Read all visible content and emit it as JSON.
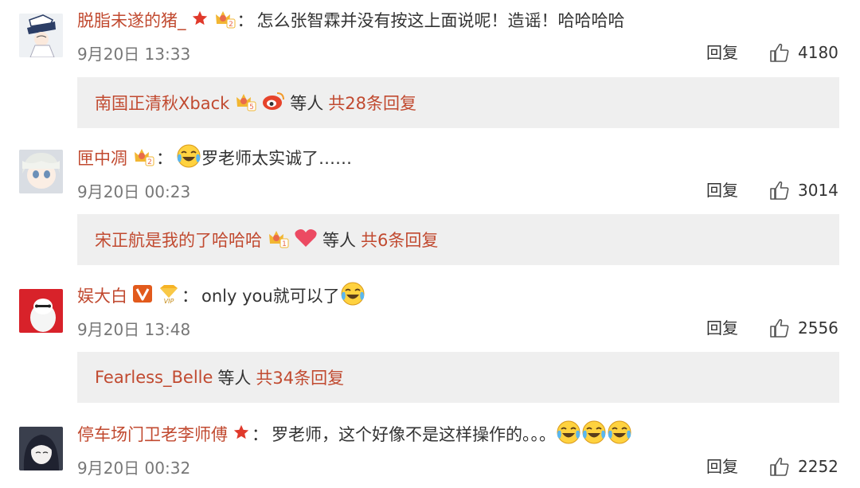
{
  "comments": [
    {
      "username": "脱脂未遂的猪_",
      "separator": "：",
      "text": "怎么张智霖并没有按这上面说呢！造谣！哈哈哈哈",
      "time": "9月20日 13:33",
      "reply_label": "回复",
      "likes": "4180",
      "sub": {
        "name": "南国正清秋Xback",
        "etc": "等人",
        "count": "共28条回复"
      }
    },
    {
      "username": "匣中凋",
      "separator": "：",
      "text": "罗老师太实诚了……",
      "time": "9月20日 00:23",
      "reply_label": "回复",
      "likes": "3014",
      "sub": {
        "name": "宋正航是我的了哈哈哈",
        "etc": "等人",
        "count": "共6条回复"
      }
    },
    {
      "username": "娱大白",
      "separator": "：",
      "text": "only you就可以了",
      "time": "9月20日 13:48",
      "reply_label": "回复",
      "likes": "2556",
      "sub": {
        "name": "Fearless_Belle",
        "etc": "等人",
        "count": "共34条回复"
      }
    },
    {
      "username": "停车场门卫老李师傅",
      "separator": "：",
      "text": "罗老师，这个好像不是这样操作的。。。",
      "time": "9月20日 00:32",
      "reply_label": "回复",
      "likes": "2252"
    }
  ],
  "colors": {
    "username": "#c14a30",
    "sub_bg": "#efefef",
    "meta": "#777777",
    "crown": "#f2b632",
    "star": "#e0392b",
    "vip_v": "#e25a1c"
  },
  "icons": [
    "star-icon",
    "crown-badge-icon",
    "weibo-logo-icon",
    "heart-icon",
    "v-verified-icon",
    "vip-diamond-icon",
    "laugh-cry-emoji-icon",
    "thumbs-up-icon"
  ]
}
